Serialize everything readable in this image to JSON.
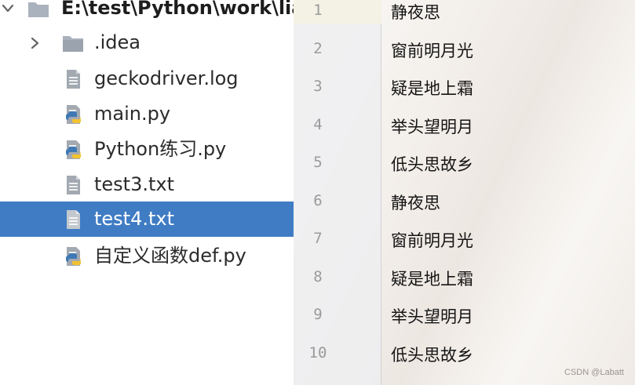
{
  "project_tree": {
    "root": {
      "label": "E:\\test\\Python\\work\\lia",
      "expanded": true
    },
    "items": [
      {
        "label": ".idea",
        "type": "folder",
        "icon": "folder-icon"
      },
      {
        "label": "geckodriver.log",
        "type": "text-file",
        "icon": "text-file-icon"
      },
      {
        "label": "main.py",
        "type": "python-file",
        "icon": "python-file-icon"
      },
      {
        "label": "Python练习.py",
        "type": "python-file",
        "icon": "python-file-icon"
      },
      {
        "label": "test3.txt",
        "type": "text-file",
        "icon": "text-file-icon"
      },
      {
        "label": "test4.txt",
        "type": "text-file",
        "icon": "text-file-icon",
        "selected": true
      },
      {
        "label": "自定义函数def.py",
        "type": "python-file",
        "icon": "python-file-icon"
      }
    ],
    "selected_color": "#3f7cc4"
  },
  "editor": {
    "lines": [
      {
        "number": "1",
        "text": "静夜思"
      },
      {
        "number": "2",
        "text": "窗前明月光"
      },
      {
        "number": "3",
        "text": "疑是地上霜"
      },
      {
        "number": "4",
        "text": "举头望明月"
      },
      {
        "number": "5",
        "text": "低头思故乡"
      },
      {
        "number": "6",
        "text": "静夜思"
      },
      {
        "number": "7",
        "text": "窗前明月光"
      },
      {
        "number": "8",
        "text": "疑是地上霜"
      },
      {
        "number": "9",
        "text": "举头望明月"
      },
      {
        "number": "10",
        "text": "低头思故乡"
      }
    ]
  },
  "watermark": "CSDN @Labatt"
}
